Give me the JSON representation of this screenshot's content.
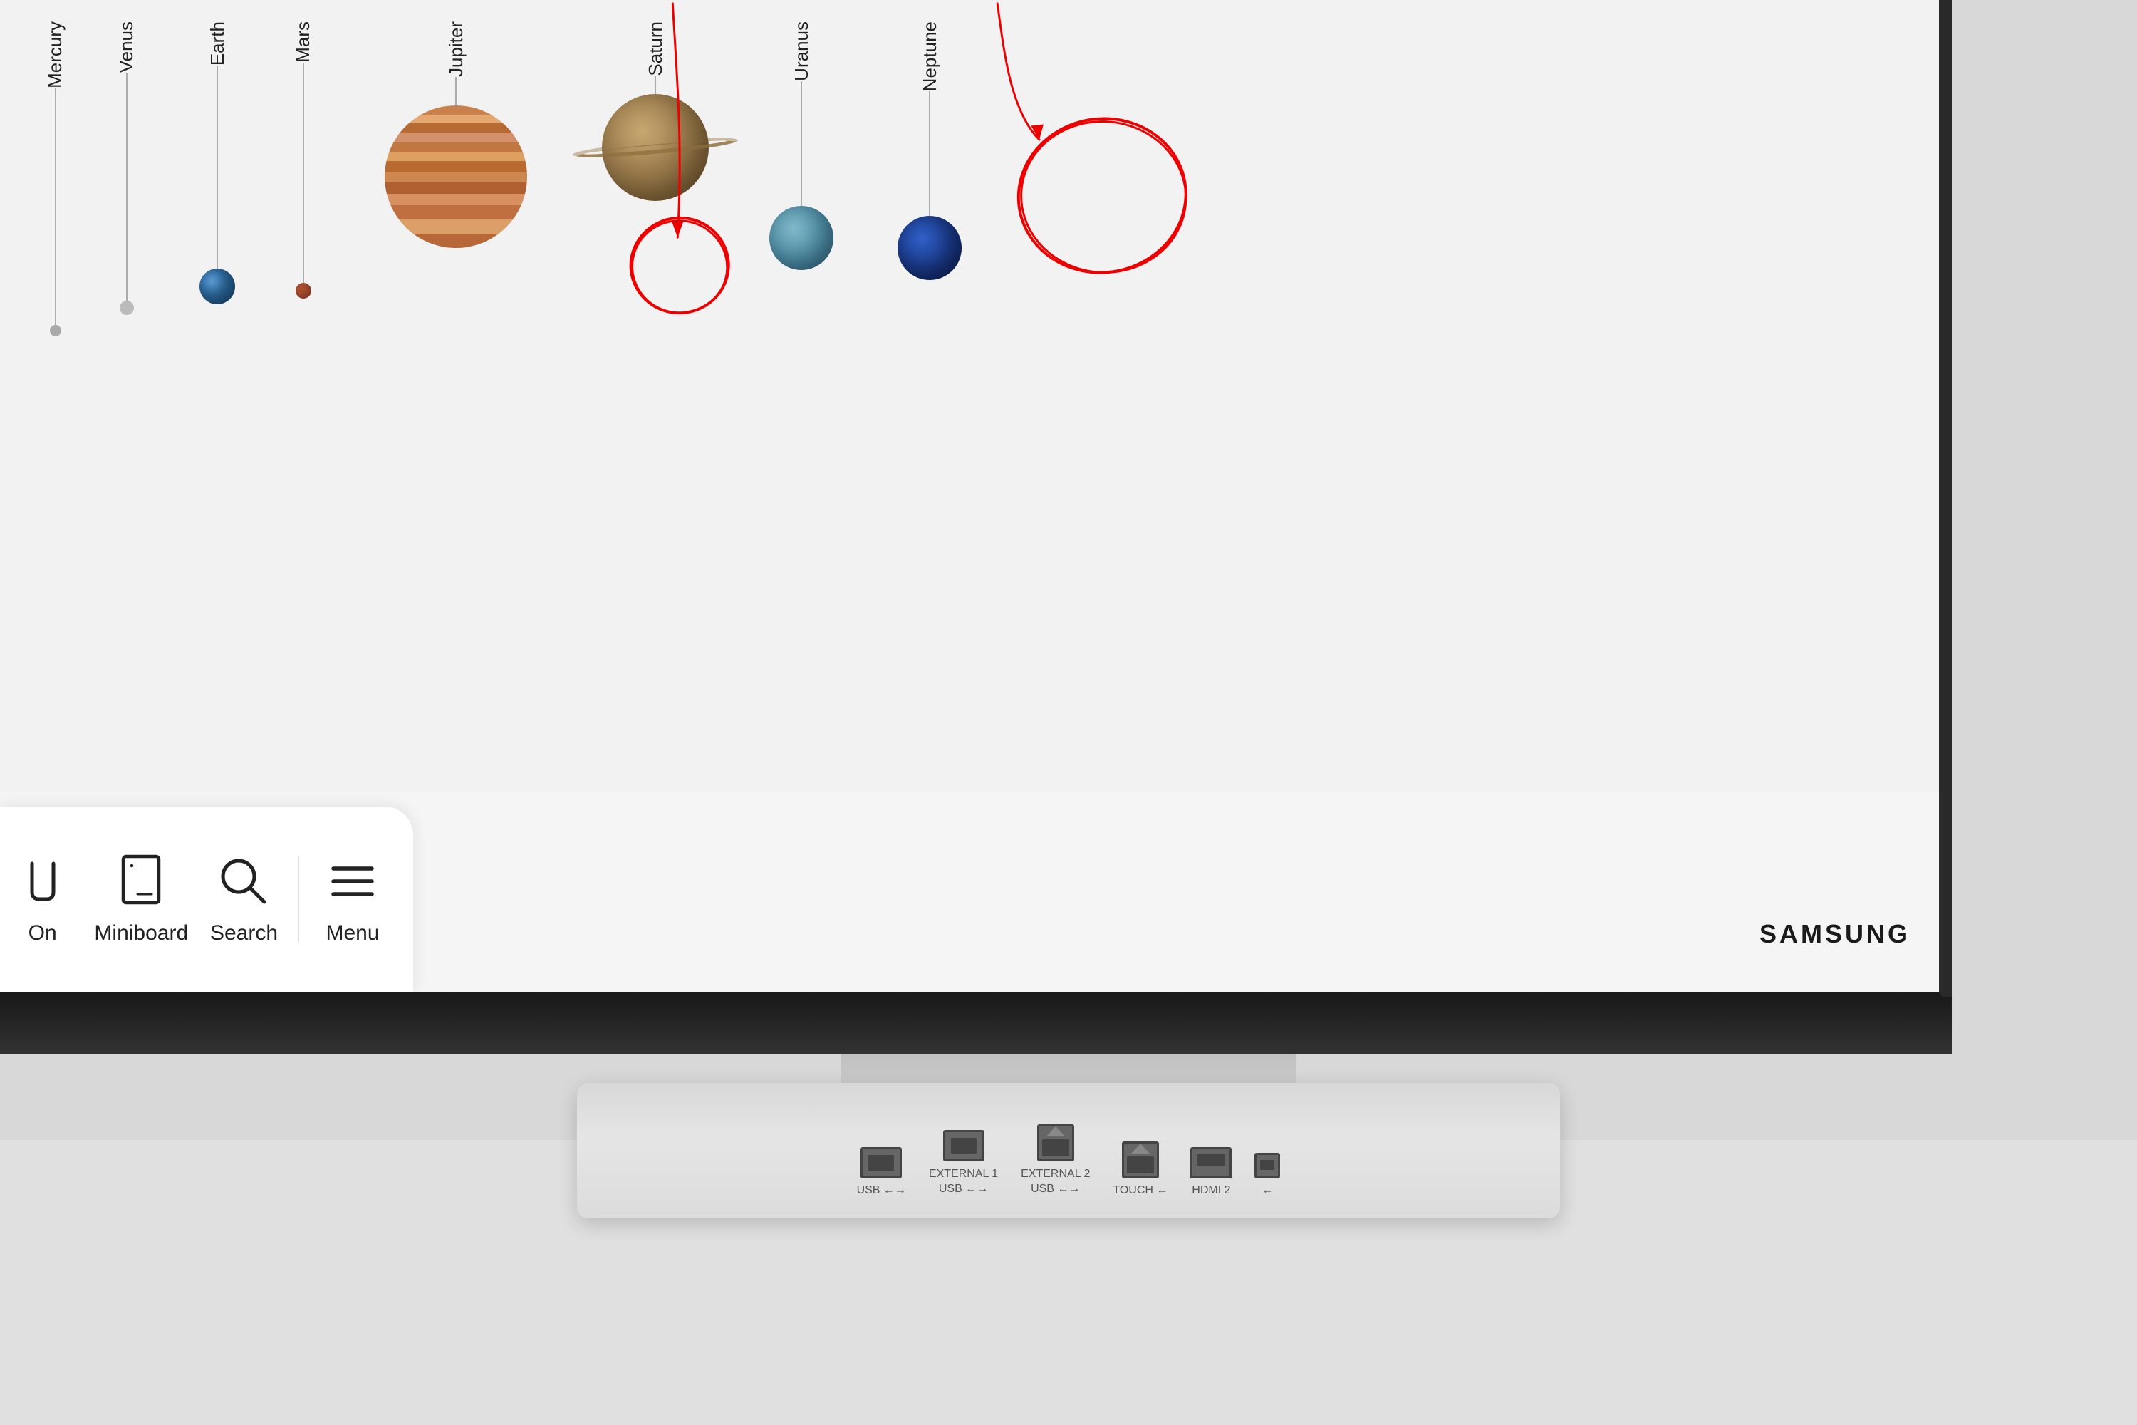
{
  "screen": {
    "background": "#f4f4f4"
  },
  "solar_system": {
    "planets": [
      {
        "id": "mercury",
        "label": "Mercury",
        "size": 18,
        "color": "#aaaaaa",
        "line_height": 300,
        "dot_offset": 0
      },
      {
        "id": "venus",
        "label": "Venus",
        "size": 22,
        "color": "#c8b080",
        "line_height": 280,
        "dot_offset": 0
      },
      {
        "id": "earth",
        "label": "Earth",
        "size": 52,
        "color": "#4477aa",
        "line_height": 260,
        "dot_offset": 0
      },
      {
        "id": "mars",
        "label": "Mars",
        "size": 24,
        "color": "#a0522d",
        "line_height": 240,
        "dot_offset": 0
      },
      {
        "id": "jupiter",
        "label": "Jupiter",
        "size": 200,
        "line_height": 100
      },
      {
        "id": "saturn",
        "label": "Saturn",
        "size": 160,
        "line_height": 80
      },
      {
        "id": "uranus",
        "label": "Uranus",
        "size": 90,
        "color": "#5b8fa8",
        "line_height": 180
      },
      {
        "id": "neptune",
        "label": "Neptune",
        "size": 90,
        "color": "#1a3a7a",
        "line_height": 180
      }
    ]
  },
  "toolbar": {
    "items": [
      {
        "id": "on",
        "label": "On",
        "icon": "power-icon"
      },
      {
        "id": "miniboard",
        "label": "Miniboard",
        "icon": "miniboard-icon"
      },
      {
        "id": "search",
        "label": "Search",
        "icon": "search-icon"
      },
      {
        "id": "menu",
        "label": "Menu",
        "icon": "menu-icon"
      }
    ]
  },
  "brand": {
    "name": "SAMSUNG"
  },
  "ports": [
    {
      "id": "usb",
      "label": "USB ←→",
      "type": "usb-a"
    },
    {
      "id": "external1-usb",
      "label": "EXTERNAL 1\nUSB ←→",
      "type": "usb-a"
    },
    {
      "id": "external2-usb",
      "label": "EXTERNAL 2\nUSB ←→",
      "type": "usb-b"
    },
    {
      "id": "touch",
      "label": "TOUCH ←",
      "type": "usb-b"
    },
    {
      "id": "hdmi2",
      "label": "HDMI 2",
      "type": "hdmi"
    },
    {
      "id": "micro",
      "label": "←",
      "type": "mini"
    }
  ]
}
